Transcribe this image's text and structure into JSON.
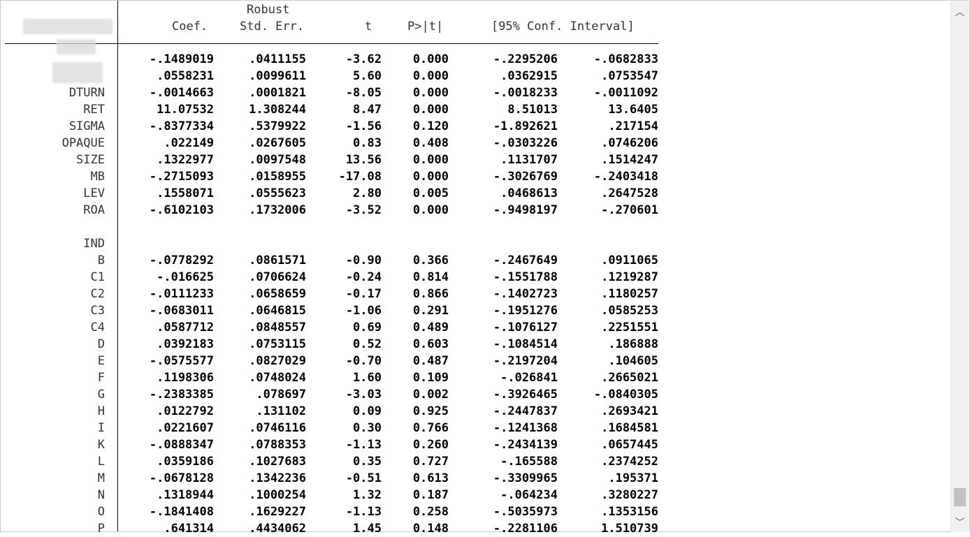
{
  "headers": {
    "robust": "Robust",
    "coef": "Coef.",
    "std_err": "Std. Err.",
    "t": "t",
    "p": "P>|t|",
    "conf_interval": "[95% Conf. Interval]"
  },
  "rows": [
    {
      "label": "",
      "coef": "-.1489019",
      "se": ".0411155",
      "t": "-3.62",
      "p": "0.000",
      "lo": "-.2295206",
      "hi": "-.0682833"
    },
    {
      "label": "",
      "coef": ".0558231",
      "se": ".0099611",
      "t": "5.60",
      "p": "0.000",
      "lo": ".0362915",
      "hi": ".0753547"
    },
    {
      "label": "DTURN",
      "coef": "-.0014663",
      "se": ".0001821",
      "t": "-8.05",
      "p": "0.000",
      "lo": "-.0018233",
      "hi": "-.0011092"
    },
    {
      "label": "RET",
      "coef": "11.07532",
      "se": "1.308244",
      "t": "8.47",
      "p": "0.000",
      "lo": "8.51013",
      "hi": "13.6405"
    },
    {
      "label": "SIGMA",
      "coef": "-.8377334",
      "se": ".5379922",
      "t": "-1.56",
      "p": "0.120",
      "lo": "-1.892621",
      "hi": ".217154"
    },
    {
      "label": "OPAQUE",
      "coef": ".022149",
      "se": ".0267605",
      "t": "0.83",
      "p": "0.408",
      "lo": "-.0303226",
      "hi": ".0746206"
    },
    {
      "label": "SIZE",
      "coef": ".1322977",
      "se": ".0097548",
      "t": "13.56",
      "p": "0.000",
      "lo": ".1131707",
      "hi": ".1514247"
    },
    {
      "label": "MB",
      "coef": "-.2715093",
      "se": ".0158955",
      "t": "-17.08",
      "p": "0.000",
      "lo": "-.3026769",
      "hi": "-.2403418"
    },
    {
      "label": "LEV",
      "coef": ".1558071",
      "se": ".0555623",
      "t": "2.80",
      "p": "0.005",
      "lo": ".0468613",
      "hi": ".2647528"
    },
    {
      "label": "ROA",
      "coef": "-.6102103",
      "se": ".1732006",
      "t": "-3.52",
      "p": "0.000",
      "lo": "-.9498197",
      "hi": "-.270601"
    },
    {
      "label": "",
      "coef": "",
      "se": "",
      "t": "",
      "p": "",
      "lo": "",
      "hi": ""
    },
    {
      "label": "IND",
      "coef": "",
      "se": "",
      "t": "",
      "p": "",
      "lo": "",
      "hi": ""
    },
    {
      "label": "B",
      "coef": "-.0778292",
      "se": ".0861571",
      "t": "-0.90",
      "p": "0.366",
      "lo": "-.2467649",
      "hi": ".0911065"
    },
    {
      "label": "C1",
      "coef": "-.016625",
      "se": ".0706624",
      "t": "-0.24",
      "p": "0.814",
      "lo": "-.1551788",
      "hi": ".1219287"
    },
    {
      "label": "C2",
      "coef": "-.0111233",
      "se": ".0658659",
      "t": "-0.17",
      "p": "0.866",
      "lo": "-.1402723",
      "hi": ".1180257"
    },
    {
      "label": "C3",
      "coef": "-.0683011",
      "se": ".0646815",
      "t": "-1.06",
      "p": "0.291",
      "lo": "-.1951276",
      "hi": ".0585253"
    },
    {
      "label": "C4",
      "coef": ".0587712",
      "se": ".0848557",
      "t": "0.69",
      "p": "0.489",
      "lo": "-.1076127",
      "hi": ".2251551"
    },
    {
      "label": "D",
      "coef": ".0392183",
      "se": ".0753115",
      "t": "0.52",
      "p": "0.603",
      "lo": "-.1084514",
      "hi": ".186888"
    },
    {
      "label": "E",
      "coef": "-.0575577",
      "se": ".0827029",
      "t": "-0.70",
      "p": "0.487",
      "lo": "-.2197204",
      "hi": ".104605"
    },
    {
      "label": "F",
      "coef": ".1198306",
      "se": ".0748024",
      "t": "1.60",
      "p": "0.109",
      "lo": "-.026841",
      "hi": ".2665021"
    },
    {
      "label": "G",
      "coef": "-.2383385",
      "se": ".078697",
      "t": "-3.03",
      "p": "0.002",
      "lo": "-.3926465",
      "hi": "-.0840305"
    },
    {
      "label": "H",
      "coef": ".0122792",
      "se": ".131102",
      "t": "0.09",
      "p": "0.925",
      "lo": "-.2447837",
      "hi": ".2693421"
    },
    {
      "label": "I",
      "coef": ".0221607",
      "se": ".0746116",
      "t": "0.30",
      "p": "0.766",
      "lo": "-.1241368",
      "hi": ".1684581"
    },
    {
      "label": "K",
      "coef": "-.0888347",
      "se": ".0788353",
      "t": "-1.13",
      "p": "0.260",
      "lo": "-.2434139",
      "hi": ".0657445"
    },
    {
      "label": "L",
      "coef": ".0359186",
      "se": ".1027683",
      "t": "0.35",
      "p": "0.727",
      "lo": "-.165588",
      "hi": ".2374252"
    },
    {
      "label": "M",
      "coef": "-.0678128",
      "se": ".1342236",
      "t": "-0.51",
      "p": "0.613",
      "lo": "-.3309965",
      "hi": ".195371"
    },
    {
      "label": "N",
      "coef": ".1318944",
      "se": ".1000254",
      "t": "1.32",
      "p": "0.187",
      "lo": "-.064234",
      "hi": ".3280227"
    },
    {
      "label": "O",
      "coef": "-.1841408",
      "se": ".1629227",
      "t": "-1.13",
      "p": "0.258",
      "lo": "-.5035973",
      "hi": ".1353156"
    },
    {
      "label": "P",
      "coef": ".641314",
      "se": ".4434062",
      "t": "1.45",
      "p": "0.148",
      "lo": "-.2281106",
      "hi": "1.510739"
    }
  ],
  "scrollbar": {
    "up_icon": "chevron-up-icon",
    "down_icon": "chevron-down-icon"
  }
}
